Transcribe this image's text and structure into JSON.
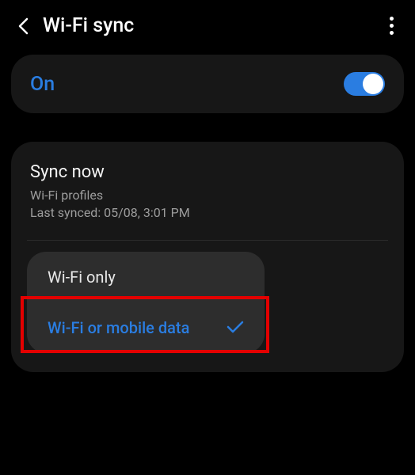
{
  "header": {
    "title": "Wi-Fi sync"
  },
  "toggle": {
    "label": "On",
    "state": true
  },
  "sync": {
    "title": "Sync now",
    "subtitle1": "Wi-Fi profiles",
    "subtitle2": "Last synced: 05/08, 3:01 PM"
  },
  "menu": {
    "items": [
      {
        "label": "Wi-Fi only",
        "selected": false
      },
      {
        "label": "Wi-Fi or mobile data",
        "selected": true
      }
    ]
  }
}
